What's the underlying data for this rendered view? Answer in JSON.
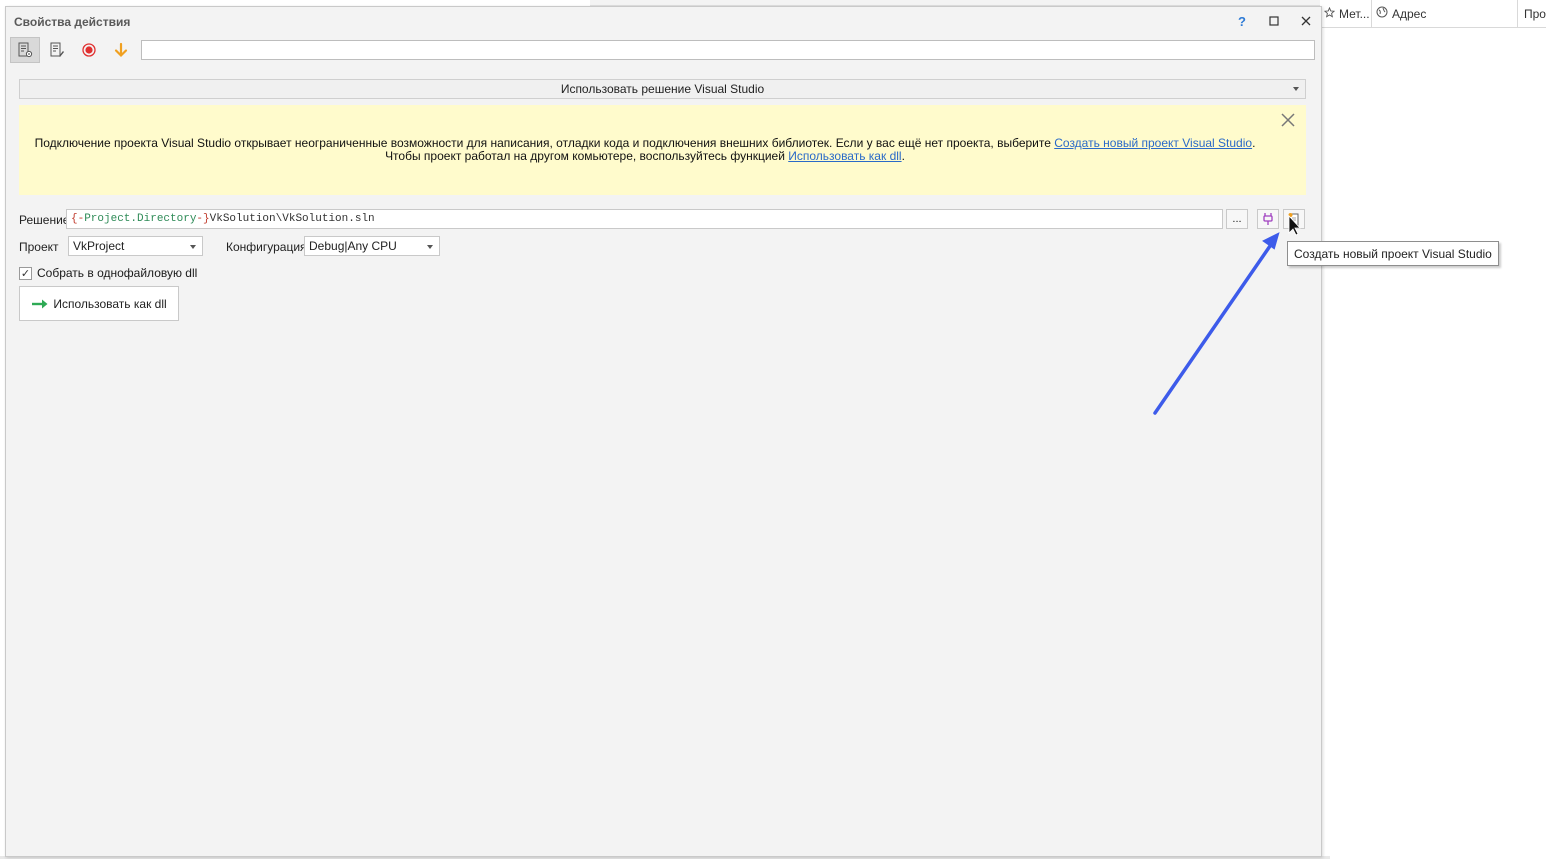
{
  "background_app": {
    "columns": [
      {
        "label": "Мет..."
      },
      {
        "label": "Адрес"
      },
      {
        "label": "Про"
      }
    ]
  },
  "dialog": {
    "title": "Свойства действия",
    "window_buttons": {
      "help": "?",
      "maximize": "□",
      "close": "✕"
    },
    "toolbar": {
      "input_value": "",
      "icons": [
        "properties-icon",
        "notes-icon",
        "record-icon",
        "down-arrow-icon"
      ]
    },
    "mode_select": {
      "selected": "Использовать решение Visual Studio"
    },
    "banner": {
      "text_part1": "Подключение проекта Visual Studio открывает неограниченные возможности для написания, отладки кода и подключения внешних библиотек. Если у вас ещё нет проекта, выберите ",
      "link1": "Создать новый проект Visual Studio",
      "text_part2": ". Чтобы проект работал на другом комьютере, воспользуйтесь функцией ",
      "link2": "Использовать как dll",
      "text_part3": "."
    },
    "solution": {
      "label": "Решение",
      "brace_open": "{-",
      "var_name": "Project.Directory",
      "brace_close": "-}",
      "path": "VkSolution\\VkSolution.sln",
      "browse_label": "..."
    },
    "tooltip": "Создать новый проект Visual Studio",
    "project": {
      "label": "Проект",
      "value": "VkProject"
    },
    "configuration": {
      "label": "Конфигурация",
      "value": "Debug|Any CPU"
    },
    "single_file_dll": {
      "label": "Собрать в однофайловую dll",
      "checked": true,
      "check_glyph": "✓"
    },
    "use_as_dll_button": {
      "label": "Использовать как dll"
    }
  },
  "colors": {
    "banner_bg": "#fffbcc",
    "link": "#2a6ac8",
    "annotation_arrow": "#3d5bea"
  }
}
